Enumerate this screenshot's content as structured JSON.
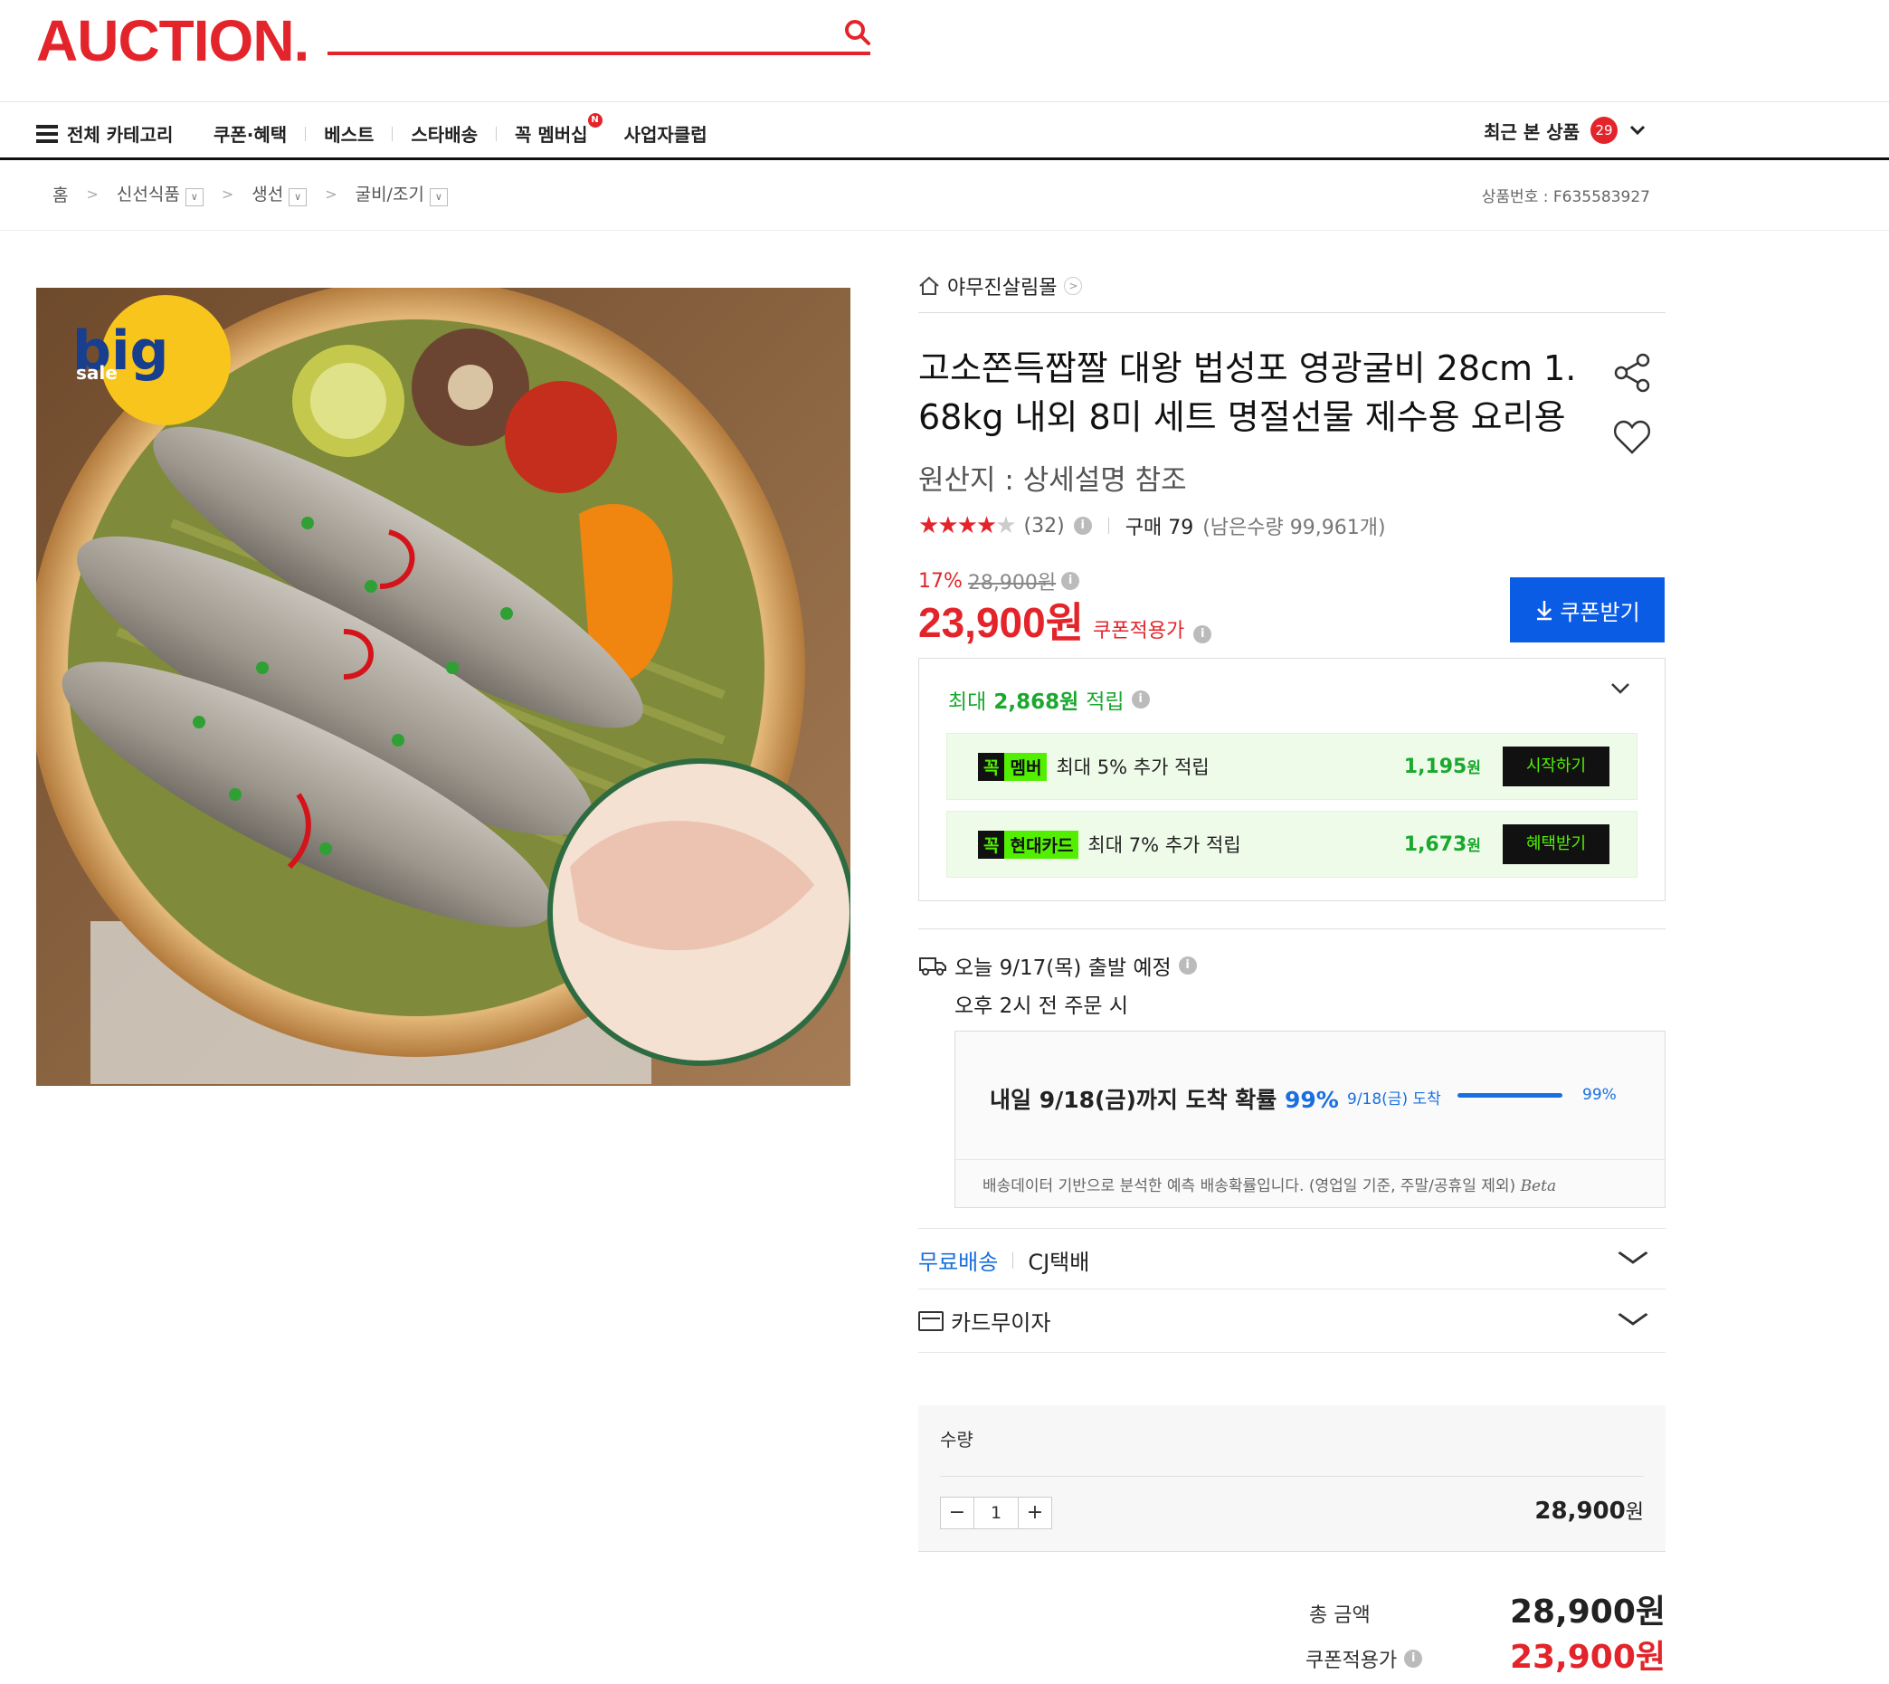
{
  "header": {
    "logo": "AUCTION."
  },
  "nav": {
    "all_categories": "전체 카테고리",
    "items": [
      "쿠폰·혜택",
      "베스트",
      "스타배송",
      "꼭 멤버십",
      "사업자클럽"
    ],
    "membership_badge": "N",
    "recent_label": "최근 본 상품",
    "recent_count": "29"
  },
  "breadcrumb": [
    "홈",
    "신선식품",
    "생선",
    "굴비/조기"
  ],
  "product_number": "상품번호 : F635583927",
  "seller": "야무진살림몰",
  "title": "고소쫀득짭짤 대왕 법성포 영광굴비 28cm 1.68kg 내외 8미 세트 명절선물 제수용 요리용",
  "origin": "원산지 : 상세설명 참조",
  "rating": {
    "stars": 4,
    "max": 5,
    "count": "(32)",
    "purchase": "구매 79",
    "stock": "(남은수량 99,961개)"
  },
  "price": {
    "discount": "17%",
    "original": "28,900원",
    "final": "23,900원",
    "coupon_label": "쿠폰적용가",
    "coupon_button": "쿠폰받기"
  },
  "reward": {
    "summary_prefix": "최대 ",
    "summary_amount": "2,868원",
    "summary_suffix": " 적립",
    "rows": [
      {
        "tag1": "꼭",
        "tag2": "멤버",
        "text": "최대 5% 추가 적립",
        "amount": "1,195",
        "unit": "원",
        "button": "시작하기"
      },
      {
        "tag1": "꼭",
        "tag2": "현대카드",
        "text": "최대 7% 추가 적립",
        "amount": "1,673",
        "unit": "원",
        "button": "혜택받기"
      }
    ]
  },
  "shipping": {
    "today": "오늘 9/17(목) 출발 예정",
    "condition": "오후 2시 전 주문 시",
    "forecast_main": "내일 9/18(금)까지 도착 확률",
    "forecast_pct": "99%",
    "forecast_date": "9/18(금) 도착",
    "forecast_bar_pct": "99%",
    "forecast_level": 0.99,
    "note": "배송데이터 기반으로 분석한 예측 배송확률입니다. (영업일 기준, 주말/공휴일 제외)",
    "beta": "Beta",
    "free": "무료배송",
    "courier": "CJ택배",
    "installment": "카드무이자"
  },
  "quantity": {
    "label": "수량",
    "value": "1",
    "price": "28,900",
    "unit": "원"
  },
  "total": {
    "label": "총 금액",
    "amount": "28,900원",
    "coupon_label": "쿠폰적용가",
    "coupon_amount": "23,900원"
  },
  "image_badge": {
    "big": "big",
    "sale": "sale"
  },
  "colors": {
    "brand": "#e3242b",
    "blue": "#0b5ce5",
    "green": "#1aa82e",
    "neon": "#52f000"
  }
}
